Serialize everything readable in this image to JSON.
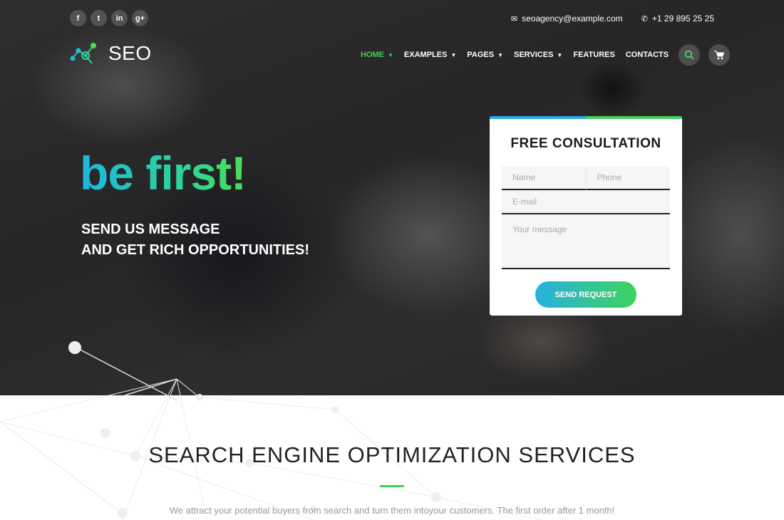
{
  "header": {
    "social": [
      {
        "icon": "facebook-icon",
        "glyph": "f"
      },
      {
        "icon": "twitter-icon",
        "glyph": "t"
      },
      {
        "icon": "linkedin-icon",
        "glyph": "in"
      },
      {
        "icon": "google-plus-icon",
        "glyph": "g+"
      }
    ],
    "email": "seoagency@example.com",
    "phone": "+1 29 895 25 25",
    "logo": "SEO",
    "nav": [
      {
        "label": "HOME",
        "dropdown": true,
        "active": true
      },
      {
        "label": "EXAMPLES",
        "dropdown": true
      },
      {
        "label": "PAGES",
        "dropdown": true
      },
      {
        "label": "SERVICES",
        "dropdown": true
      },
      {
        "label": "FEATURES",
        "dropdown": false
      },
      {
        "label": "CONTACTS",
        "dropdown": false
      }
    ]
  },
  "hero": {
    "headline": "be first!",
    "sub_line1": "SEND US MESSAGE",
    "sub_line2": "AND GET RICH OPPORTUNITIES!"
  },
  "form": {
    "title": "FREE CONSULTATION",
    "name_placeholder": "Name",
    "phone_placeholder": "Phone",
    "email_placeholder": "E-mail",
    "message_placeholder": "Your message",
    "submit_label": "SEND REQUEST"
  },
  "section": {
    "title": "SEARCH ENGINE OPTIMIZATION SERVICES",
    "description": "We attract your potential buyers from search and turn them intoyour customers. The first order after 1 month!"
  },
  "colors": {
    "accent_green": "#3fd35c",
    "accent_blue": "#27a8e0"
  }
}
